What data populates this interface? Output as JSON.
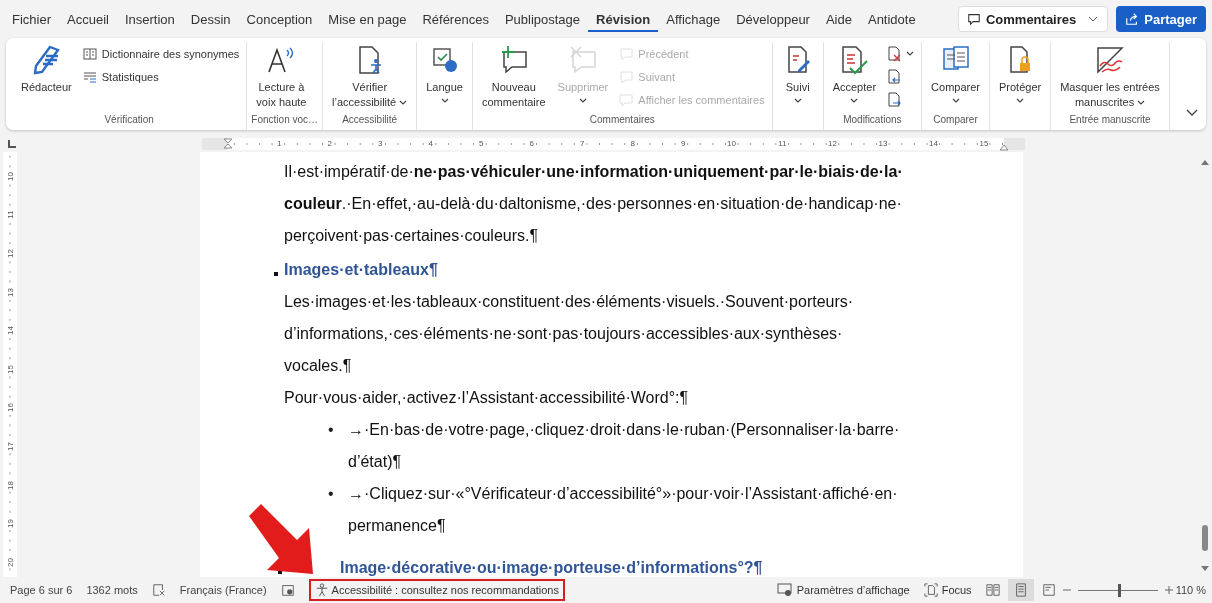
{
  "tabs": [
    {
      "label": "Fichier",
      "selected": false
    },
    {
      "label": "Accueil",
      "selected": false
    },
    {
      "label": "Insertion",
      "selected": false
    },
    {
      "label": "Dessin",
      "selected": false
    },
    {
      "label": "Conception",
      "selected": false
    },
    {
      "label": "Mise en page",
      "selected": false
    },
    {
      "label": "Références",
      "selected": false
    },
    {
      "label": "Publipostage",
      "selected": false
    },
    {
      "label": "Révision",
      "selected": true
    },
    {
      "label": "Affichage",
      "selected": false
    },
    {
      "label": "Développeur",
      "selected": false
    },
    {
      "label": "Aide",
      "selected": false
    },
    {
      "label": "Antidote",
      "selected": false
    }
  ],
  "comments_button": {
    "label": "Commentaires"
  },
  "share_button": {
    "label": "Partager"
  },
  "ribbon": {
    "groups": [
      {
        "label": "Vérification",
        "items": [
          {
            "kind": "large",
            "label": [
              "Rédacteur"
            ],
            "disabled": false,
            "dropdown": false
          },
          {
            "kind": "stack",
            "items": [
              {
                "label": "Dictionnaire des synonymes",
                "disabled": false,
                "dropdown": false
              },
              {
                "label": "Statistiques",
                "disabled": false,
                "dropdown": false
              }
            ]
          }
        ]
      },
      {
        "label": "Fonction voc…",
        "items": [
          {
            "kind": "large",
            "label": [
              "Lecture à",
              "voix haute"
            ],
            "disabled": false,
            "dropdown": false
          }
        ]
      },
      {
        "label": "Accessibilité",
        "items": [
          {
            "kind": "large",
            "label": [
              "Vérifier",
              "l’accessibilité"
            ],
            "disabled": false,
            "dropdown": true
          }
        ]
      },
      {
        "items": [
          {
            "kind": "large",
            "label": [
              "Langue"
            ],
            "disabled": false,
            "dropdown": true
          }
        ]
      },
      {
        "label": "Commentaires",
        "items": [
          {
            "kind": "large",
            "label": [
              "Nouveau",
              "commentaire"
            ],
            "disabled": false,
            "dropdown": false
          },
          {
            "kind": "large",
            "label": [
              "Supprimer"
            ],
            "disabled": true,
            "dropdown": true
          },
          {
            "kind": "stack",
            "items": [
              {
                "label": "Précédent",
                "disabled": true,
                "dropdown": false
              },
              {
                "label": "Suivant",
                "disabled": true,
                "dropdown": false
              },
              {
                "label": "Afficher les commentaires",
                "disabled": true,
                "dropdown": false
              }
            ]
          }
        ]
      },
      {
        "items": [
          {
            "kind": "large",
            "label": [
              "Suivi"
            ],
            "disabled": false,
            "dropdown": true
          }
        ]
      },
      {
        "label": "Modifications",
        "items": [
          {
            "kind": "large",
            "label": [
              "Accepter"
            ],
            "disabled": false,
            "dropdown": true
          },
          {
            "kind": "stack",
            "items": [
              {
                "disabled": false,
                "dropdown": true
              },
              {
                "disabled": false,
                "dropdown": false
              },
              {
                "disabled": false,
                "dropdown": false
              }
            ]
          }
        ]
      },
      {
        "label": "Comparer",
        "items": [
          {
            "kind": "large",
            "label": [
              "Comparer"
            ],
            "disabled": false,
            "dropdown": true
          }
        ]
      },
      {
        "items": [
          {
            "kind": "large",
            "label": [
              "Protéger"
            ],
            "disabled": false,
            "dropdown": true
          }
        ]
      },
      {
        "label": "Entrée manuscrite",
        "items": [
          {
            "kind": "large",
            "label": [
              "Masquer les entrées",
              "manuscrites"
            ],
            "disabled": false,
            "dropdown": true
          }
        ]
      }
    ]
  },
  "ruler": {
    "numbers": [
      "1",
      "2",
      "3",
      "4",
      "5",
      "6",
      "7",
      "8",
      "9",
      "10",
      "11",
      "12",
      "13",
      "14",
      "15"
    ]
  },
  "vertical_ruler": {
    "numbers": [
      "10",
      "11",
      "12",
      "13",
      "14",
      "15",
      "16",
      "17",
      "18",
      "19",
      "20"
    ]
  },
  "document": {
    "blocks": [
      {
        "kind": "paragraph",
        "lines": [
          "Il·est·impératif·de·**ne·pas·véhiculer·une·information·uniquement·par·le·biais·de·la·**",
          "**couleur**.·En·effet,·au-delà·du·daltonisme,·des·personnes·en·situation·de·handicap·ne·",
          "perçoivent·pas·certaines·couleurs.¶"
        ]
      },
      {
        "kind": "heading",
        "lines": [
          "Images·et·tableaux¶"
        ]
      },
      {
        "kind": "paragraph",
        "lines": [
          "Les·images·et·les·tableaux·constituent·des·éléments·visuels.·Souvent·porteurs·",
          "d’informations,·ces·éléments·ne·sont·pas·toujours·accessibles·aux·synthèses·",
          "vocales.¶"
        ]
      },
      {
        "kind": "paragraph",
        "lines": [
          "Pour·vous·aider,·activez·l’Assistant·accessibilité·Word°:¶"
        ]
      },
      {
        "kind": "bullet",
        "marker": "•",
        "lines": [
          "→·En·bas·de·votre·page,·cliquez·droit·dans·le·ruban·(Personnaliser·la·barre·",
          "d’état)¶"
        ]
      },
      {
        "kind": "bullet",
        "marker": "•",
        "lines": [
          "→·Cliquez·sur·«°Vérificateur·d’accessibilité°»·pour·voir·l’Assistant·affiché·en·",
          "permanence¶"
        ]
      },
      {
        "kind": "subheading",
        "lines": [
          "Image·décorative·ou·image·porteuse·d’informations°?¶"
        ]
      }
    ]
  },
  "status_bar": {
    "page": "Page 6 sur 6",
    "words": "1362 mots",
    "language": "Français (France)",
    "accessibility": {
      "label": "Accessibilité : consultez nos recommandations",
      "highlighted": true
    },
    "display_settings": "Paramètres d’affichage",
    "focus": "Focus",
    "views": [
      {
        "selected": false
      },
      {
        "selected": true
      },
      {
        "selected": false
      }
    ],
    "zoom": {
      "level": 0.52,
      "reading": "110 %"
    }
  }
}
